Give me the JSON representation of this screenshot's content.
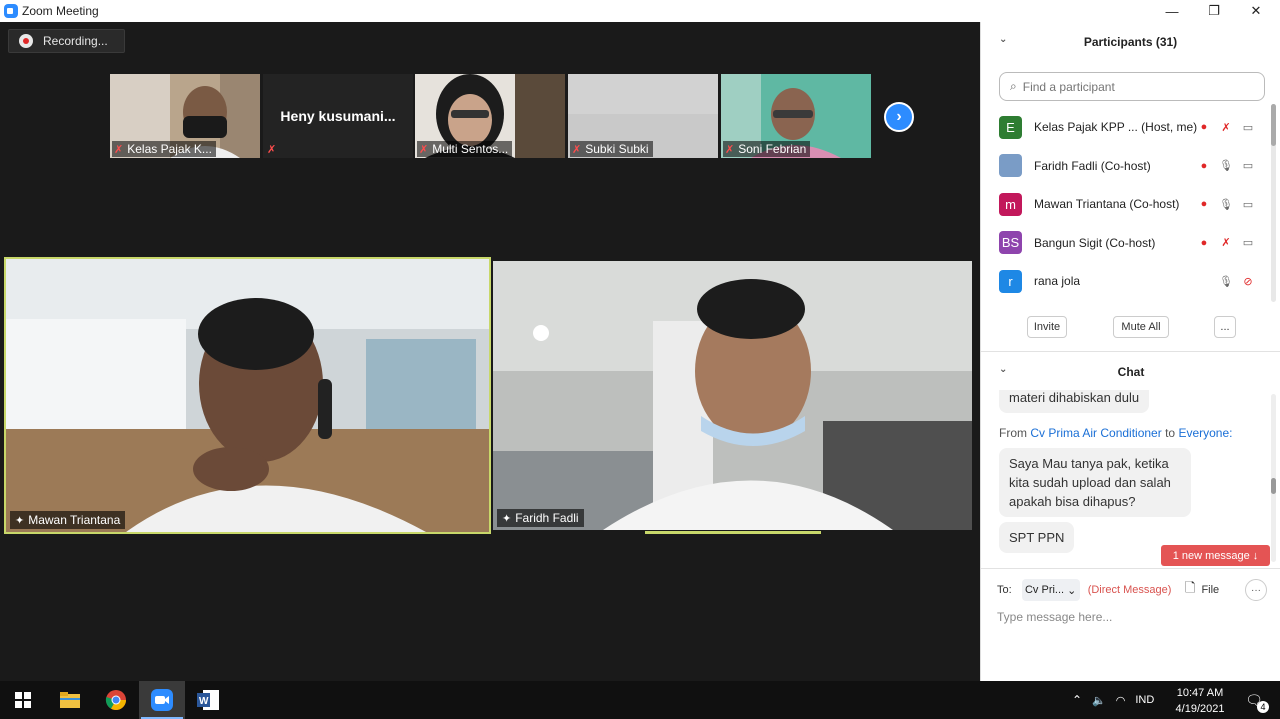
{
  "window": {
    "title": "Zoom Meeting",
    "minimize": "—",
    "restore": "❐",
    "close": "✕"
  },
  "recording": {
    "label": "Recording..."
  },
  "thumbnails": [
    {
      "name": "Kelas Pajak K...",
      "muted": true
    },
    {
      "name": "",
      "display_text": "Heny  kusumani...",
      "muted": true
    },
    {
      "name": "Multi Sentos...",
      "muted": true
    },
    {
      "name": "Subki Subki",
      "muted": true
    },
    {
      "name": "Soni Febrian",
      "muted": true
    }
  ],
  "next_page": "›",
  "videos": [
    {
      "name": "Mawan Triantana",
      "active_speaker": true
    },
    {
      "name": "Faridh Fadli",
      "active_speaker": false
    }
  ],
  "participants": {
    "header": "Participants (31)",
    "search_placeholder": "Find a participant",
    "list": [
      {
        "initial": "E",
        "name": "Kelas Pajak KPP ... (Host, me)",
        "color": "#2e7d32",
        "recording": true,
        "mic_muted": true,
        "video": "on"
      },
      {
        "initial": "",
        "name": "Faridh Fadli (Co-host)",
        "color": "#7a9cc6",
        "recording": true,
        "mic_muted": false,
        "video": "on"
      },
      {
        "initial": "m",
        "name": "Mawan Triantana (Co-host)",
        "color": "#c2185b",
        "recording": true,
        "mic_muted": false,
        "video": "on"
      },
      {
        "initial": "BS",
        "name": "Bangun Sigit (Co-host)",
        "color": "#8e44ad",
        "recording": true,
        "mic_muted": true,
        "video": "on"
      },
      {
        "initial": "r",
        "name": "rana jola",
        "color": "#1e88e5",
        "recording": false,
        "mic_muted": false,
        "video": "off"
      }
    ],
    "buttons": {
      "invite": "Invite",
      "mute_all": "Mute All",
      "more": "..."
    }
  },
  "chat": {
    "header": "Chat",
    "prev_message_fragment": "materi dihabiskan dulu",
    "from_prefix": "From",
    "sender": "Cv Prima Air Conditioner",
    "to_word": "to",
    "recipient": "Everyone:",
    "message_line1": "Saya Mau tanya pak, ketika",
    "message_line2": "kita sudah upload dan salah",
    "message_line3": "apakah bisa dihapus?",
    "message2": "SPT PPN",
    "new_message": "1 new message ↓",
    "to_label": "To:",
    "to_value": "Cv Pri...",
    "direct_message": "(Direct Message)",
    "file_label": "File",
    "more": "···",
    "input_placeholder": "Type message here..."
  },
  "taskbar": {
    "tray_language": "IND",
    "time": "10:47 AM",
    "date": "4/19/2021",
    "notification_count": "4"
  }
}
